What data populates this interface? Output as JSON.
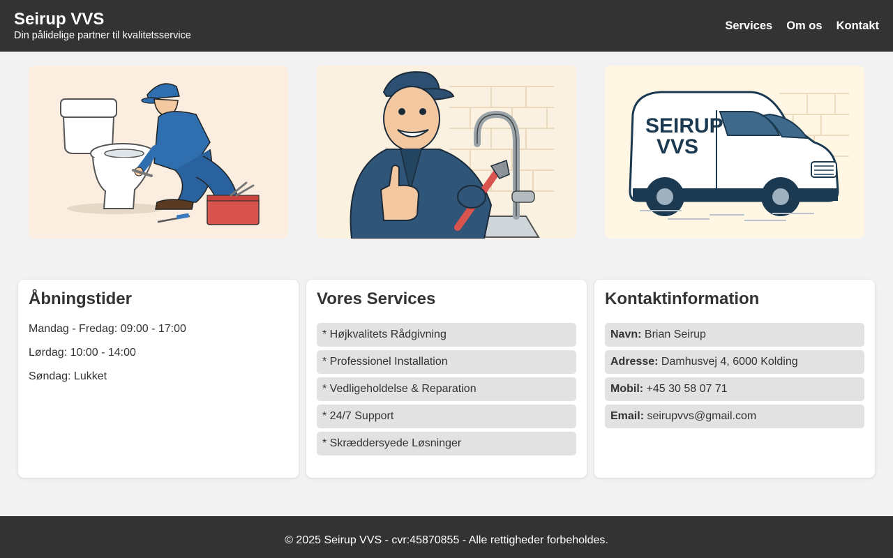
{
  "header": {
    "title": "Seirup VVS",
    "tagline": "Din pålidelige partner til kvalitetsservice",
    "nav": [
      {
        "label": "Services"
      },
      {
        "label": "Om os"
      },
      {
        "label": "Kontakt"
      }
    ]
  },
  "gallery": {
    "van_logo": "SEIRUP VVS",
    "icons": [
      "plumber-toilet-illustration",
      "plumber-thumbs-up-illustration",
      "van-illustration"
    ]
  },
  "hours": {
    "heading": "Åbningstider",
    "lines": [
      "Mandag - Fredag: 09:00 - 17:00",
      "Lørdag: 10:00 - 14:00",
      "Søndag: Lukket"
    ]
  },
  "services": {
    "heading": "Vores Services",
    "items": [
      "* Højkvalitets Rådgivning",
      "* Professionel Installation",
      "* Vedligeholdelse & Reparation",
      "* 24/7 Support",
      "* Skræddersyede Løsninger"
    ]
  },
  "contact": {
    "heading": "Kontaktinformation",
    "items": [
      {
        "label": "Navn:",
        "value": " Brian Seirup"
      },
      {
        "label": "Adresse:",
        "value": " Damhusvej 4, 6000 Kolding"
      },
      {
        "label": "Mobil:",
        "value": " +45 30 58 07 71"
      },
      {
        "label": "Email:",
        "value": " seirupvvs@gmail.com"
      }
    ]
  },
  "footer": {
    "text": "© 2025 Seirup VVS - cvr:45870855 - Alle rettigheder forbeholdes."
  },
  "colors": {
    "header_bg": "#333333",
    "page_bg": "#f2f2f2",
    "pill_bg": "#e2e2e2",
    "uniform_blue": "#2f6fb0",
    "toolbox_red": "#d9534f"
  }
}
